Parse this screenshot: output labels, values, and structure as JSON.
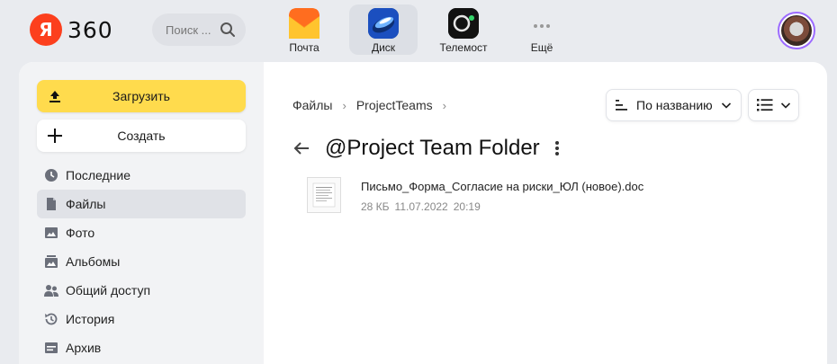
{
  "header": {
    "logo_letter": "Я",
    "logo_text": "360",
    "search_placeholder": "Поиск ...",
    "apps": [
      {
        "label": "Почта",
        "icon": "mail-icon"
      },
      {
        "label": "Диск",
        "icon": "disk-icon"
      },
      {
        "label": "Телемост",
        "icon": "telemost-icon"
      },
      {
        "label": "Ещё",
        "icon": "more-apps-icon"
      }
    ],
    "active_app": "Диск",
    "brand_color": "#fc3f1d"
  },
  "sidebar": {
    "upload_label": "Загрузить",
    "create_label": "Создать",
    "items": [
      {
        "label": "Последние",
        "icon": "clock-icon"
      },
      {
        "label": "Файлы",
        "icon": "file-icon"
      },
      {
        "label": "Фото",
        "icon": "photo-icon"
      },
      {
        "label": "Альбомы",
        "icon": "album-icon"
      },
      {
        "label": "Общий доступ",
        "icon": "shared-icon"
      },
      {
        "label": "История",
        "icon": "history-icon"
      },
      {
        "label": "Архив",
        "icon": "archive-icon"
      }
    ],
    "active_item": "Файлы",
    "accent_color": "#ffdb4d"
  },
  "main": {
    "breadcrumbs": [
      "Файлы",
      "ProjectTeams"
    ],
    "breadcrumb_sep": "›",
    "sort_label": "По названию",
    "folder_title": "@Project Team Folder",
    "files": [
      {
        "name": "Письмо_Форма_Согласие на риски_ЮЛ (новое).doc",
        "size": "28 КБ",
        "date": "11.07.2022",
        "time": "20:19"
      }
    ]
  }
}
